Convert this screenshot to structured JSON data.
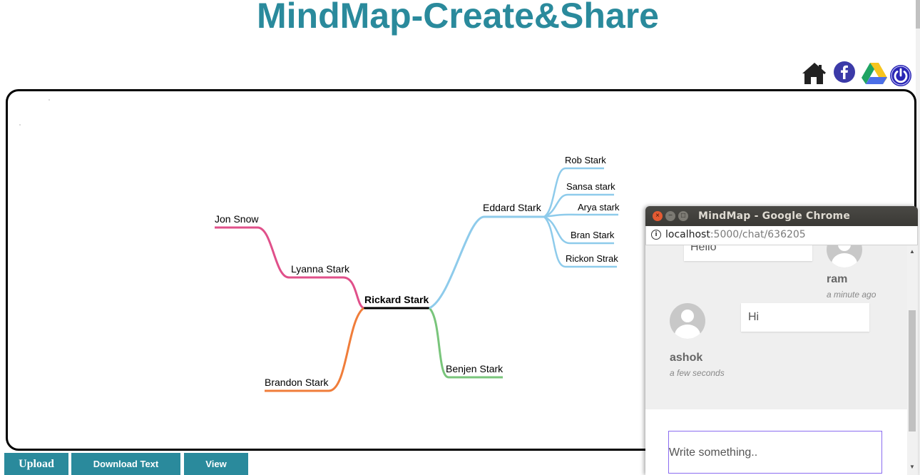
{
  "header": {
    "title": "MindMap-Create&Share"
  },
  "top_icons": [
    "home-icon",
    "facebook-icon",
    "google-drive-icon",
    "power-icon"
  ],
  "colors": {
    "accent": "#2a8a9c",
    "branch_pink": "#e0508a",
    "branch_orange": "#f07d3a",
    "branch_blue": "#8ecbeb",
    "branch_green": "#79c57b",
    "root_line": "#000000"
  },
  "mindmap": {
    "root": "Rickard Stark",
    "nodes": {
      "jon_snow": "Jon Snow",
      "lyanna_stark": "Lyanna Stark",
      "brandon_stark": "Brandon Stark",
      "benjen_stark": "Benjen Stark",
      "eddard_stark": "Eddard Stark",
      "rob_stark": "Rob Stark",
      "sansa_stark": "Sansa stark",
      "arya_stark": "Arya stark",
      "bran_stark": "Bran Stark",
      "rickon_strak": "Rickon Strak"
    }
  },
  "buttons": {
    "upload": "Upload",
    "download_text": "Download Text",
    "view": "View"
  },
  "chat_window": {
    "title": "MindMap - Google Chrome",
    "url_host": "localhost",
    "url_rest": ":5000/chat/636205",
    "messages": [
      {
        "user": "ram",
        "text": "Hello",
        "time": "a minute ago"
      },
      {
        "user": "ashok",
        "text": "Hi",
        "time": "a few seconds"
      }
    ],
    "compose_placeholder": "Write something.."
  }
}
